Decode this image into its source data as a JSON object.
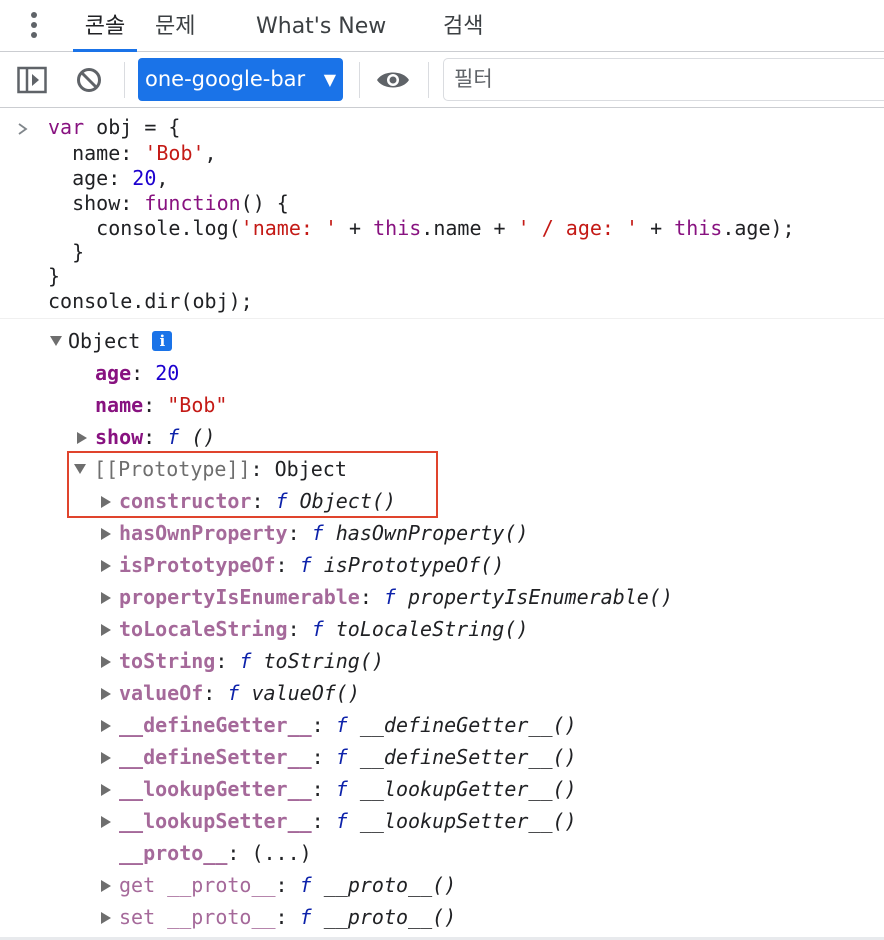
{
  "tabs": [
    {
      "label": "콘솔",
      "active": true
    },
    {
      "label": "문제",
      "active": false
    },
    {
      "label": "What's New",
      "active": false
    },
    {
      "label": "검색",
      "active": false
    }
  ],
  "toolbar": {
    "context": "one-google-bar",
    "context_arrow": "▼",
    "filter_placeholder": "필터"
  },
  "input": {
    "prompt": ">",
    "tokens": {
      "var": "var",
      "obj_open": " obj = {",
      "name_key": "  name: ",
      "name_val": "'Bob'",
      "comma": ",",
      "age_key": "  age: ",
      "age_val": "20",
      "show_key": "  show: ",
      "function": "function",
      "fn_sig": "() {",
      "log_call": "    console.log(",
      "s1": "'name: '",
      "plus": " + ",
      "this": "this",
      "dot_name": ".name",
      "s2": "' / age: '",
      "dot_age": ".age);",
      "close_inner": "  }",
      "close_outer": "}",
      "dir_line": "console.dir(obj);"
    }
  },
  "output": {
    "object_label": "Object",
    "info_icon": "i",
    "props": [
      {
        "key": "age",
        "value": "20"
      },
      {
        "key": "name",
        "value": "\"Bob\""
      },
      {
        "key": "show",
        "value": "()"
      }
    ],
    "prototype_label": "[[Prototype]]",
    "prototype_value": "Object",
    "f_symbol": "f",
    "constructor_key": "constructor",
    "constructor_value": "Object()",
    "methods": [
      {
        "key": "hasOwnProperty",
        "value": "hasOwnProperty()"
      },
      {
        "key": "isPrototypeOf",
        "value": "isPrototypeOf()"
      },
      {
        "key": "propertyIsEnumerable",
        "value": "propertyIsEnumerable()"
      },
      {
        "key": "toLocaleString",
        "value": "toLocaleString()"
      },
      {
        "key": "toString",
        "value": "toString()"
      },
      {
        "key": "valueOf",
        "value": "valueOf()"
      },
      {
        "key": "__defineGetter__",
        "value": "__defineGetter__()"
      },
      {
        "key": "__defineSetter__",
        "value": "__defineSetter__()"
      },
      {
        "key": "__lookupGetter__",
        "value": "__lookupGetter__()"
      },
      {
        "key": "__lookupSetter__",
        "value": "__lookupSetter__()"
      }
    ],
    "proto_key": "__proto__",
    "proto_value": "(...)",
    "getter": {
      "prefix": "get ",
      "key": "__proto__",
      "value": "__proto__()"
    },
    "setter": {
      "prefix": "set ",
      "key": "__proto__",
      "value": "__proto__()"
    },
    "colon": ": "
  }
}
